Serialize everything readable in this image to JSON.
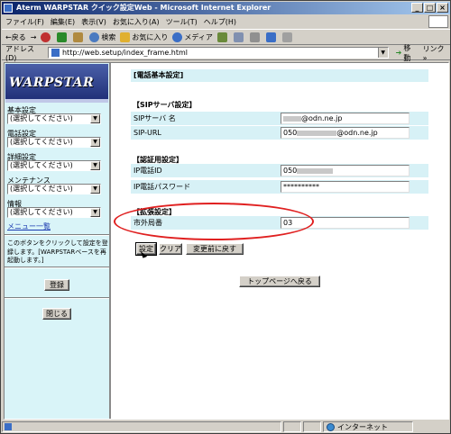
{
  "window": {
    "title": "Aterm WARPSTAR クイック設定Web - Microsoft Internet Explorer"
  },
  "menu": [
    "ファイル(F)",
    "編集(E)",
    "表示(V)",
    "お気に入り(A)",
    "ツール(T)",
    "ヘルプ(H)"
  ],
  "toolbar": {
    "back": "←戻る",
    "forward": "→",
    "search": "検索",
    "favorites": "お気に入り",
    "media": "メディア"
  },
  "address": {
    "label": "アドレス(D)",
    "url": "http://web.setup/index_frame.html",
    "go": "移動",
    "links": "リンク »"
  },
  "sidebar": {
    "logo": "WARPSTAR",
    "groups": [
      {
        "label": "基本設定",
        "value": "(選択してください)"
      },
      {
        "label": "電話設定",
        "value": "(選択してください)"
      },
      {
        "label": "詳細設定",
        "value": "(選択してください)"
      },
      {
        "label": "メンテナンス",
        "value": "(選択してください)"
      },
      {
        "label": "情報",
        "value": "(選択してください)"
      }
    ],
    "menu_list": "メニュー一覧",
    "help_text": "このボタンをクリックして設定を登録します。[WARPSTARベースを再起動します。]",
    "register_button": "登録",
    "close_button": "閉じる"
  },
  "main": {
    "page_title": "[電話基本設定]",
    "sections": {
      "sip": "【SIPサーバ設定】",
      "auth": "【認証用設定】",
      "ext": "【拡張設定】"
    },
    "fields": {
      "sip_server": {
        "label": "SIPサーバ 名",
        "value": "@odn.ne.jp"
      },
      "sip_url": {
        "label": "SIP-URL",
        "prefix": "050",
        "value": "@odn.ne.jp"
      },
      "ip_phone_id": {
        "label": "IP電話ID",
        "value": "050"
      },
      "ip_phone_password": {
        "label": "IP電話パスワード",
        "value": "**********"
      },
      "area_code": {
        "label": "市外局番",
        "value": "03"
      }
    },
    "buttons": {
      "set": "設定",
      "clear": "クリア",
      "revert": "変更前に戻す",
      "top": "トップページへ戻る"
    }
  },
  "status": {
    "zone": "インターネット"
  },
  "colors": {
    "highlight": "#e02020",
    "row_bg": "#d7f1f6",
    "sidebar_bg": "#d9f4f8"
  }
}
